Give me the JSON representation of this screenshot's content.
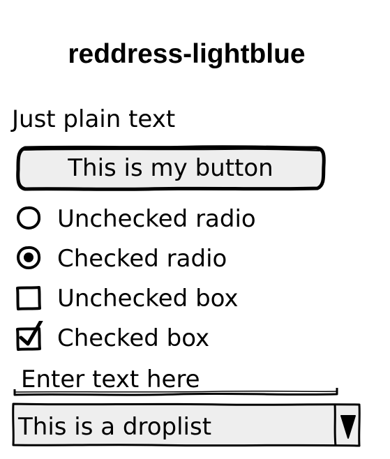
{
  "title": "reddress-lightblue",
  "plain_text": "Just plain text",
  "button": {
    "label": "This is my button"
  },
  "radios": [
    {
      "label": "Unchecked radio",
      "checked": false
    },
    {
      "label": "Checked radio",
      "checked": true
    }
  ],
  "checkboxes": [
    {
      "label": "Unchecked box",
      "checked": false
    },
    {
      "label": "Checked box",
      "checked": true
    }
  ],
  "text_input": {
    "value": "Enter text here"
  },
  "droplist": {
    "selected": "This is a droplist"
  },
  "colors": {
    "stroke": "#000000",
    "fill": "#eeeeee",
    "background": "#ffffff"
  }
}
